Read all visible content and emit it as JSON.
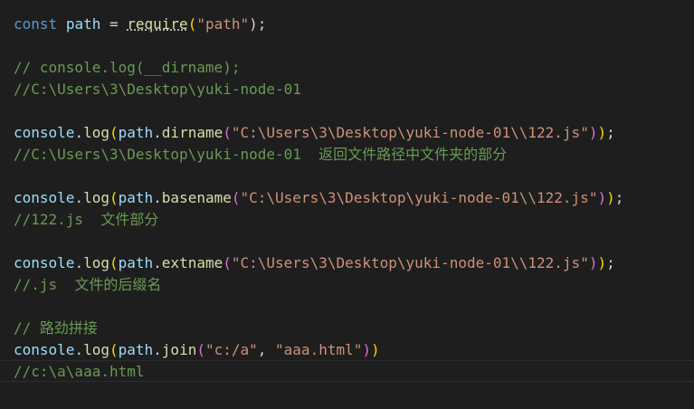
{
  "code": {
    "line1": {
      "kw": "const",
      "var": "path",
      "op": " = ",
      "fn": "require",
      "open": "(",
      "str": "\"path\"",
      "close": ");"
    },
    "line3": "// console.log(__dirname);",
    "line4": "//C:\\Users\\3\\Desktop\\yuki-node-01",
    "line6": {
      "obj": "console",
      "dot1": ".",
      "method": "log",
      "open1": "(",
      "var": "path",
      "dot2": ".",
      "fn": "dirname",
      "open2": "(",
      "str": "\"C:\\Users\\3\\Desktop\\yuki-node-01\\\\122.js\"",
      "close2": ")",
      "close1": ")",
      "semi": ";"
    },
    "line7": "//C:\\Users\\3\\Desktop\\yuki-node-01  返回文件路径中文件夹的部分",
    "line9": {
      "obj": "console",
      "dot1": ".",
      "method": "log",
      "open1": "(",
      "var": "path",
      "dot2": ".",
      "fn": "basename",
      "open2": "(",
      "str": "\"C:\\Users\\3\\Desktop\\yuki-node-01\\\\122.js\"",
      "close2": ")",
      "close1": ")",
      "semi": ";"
    },
    "line10": "//122.js  文件部分",
    "line12": {
      "obj": "console",
      "dot1": ".",
      "method": "log",
      "open1": "(",
      "var": "path",
      "dot2": ".",
      "fn": "extname",
      "open2": "(",
      "str": "\"C:\\Users\\3\\Desktop\\yuki-node-01\\\\122.js\"",
      "close2": ")",
      "close1": ")",
      "semi": ";"
    },
    "line13": "//.js  文件的后缀名",
    "line15": "// 路劲拼接",
    "line16": {
      "obj": "console",
      "dot1": ".",
      "method": "log",
      "open1": "(",
      "var": "path",
      "dot2": ".",
      "fn": "join",
      "open2": "(",
      "str1": "\"c:/a\"",
      "comma": ", ",
      "str2": "\"aaa.html\"",
      "close2": ")",
      "close1": ")"
    },
    "line17": "//c:\\a\\aaa.html"
  },
  "colors": {
    "background": "#1e1e1e",
    "keyword": "#569cd6",
    "variable": "#9cdcfe",
    "function": "#dcdcaa",
    "string": "#ce9178",
    "comment": "#6a9955",
    "bracket_outer": "#ffd700",
    "bracket_inner": "#da70d6"
  }
}
